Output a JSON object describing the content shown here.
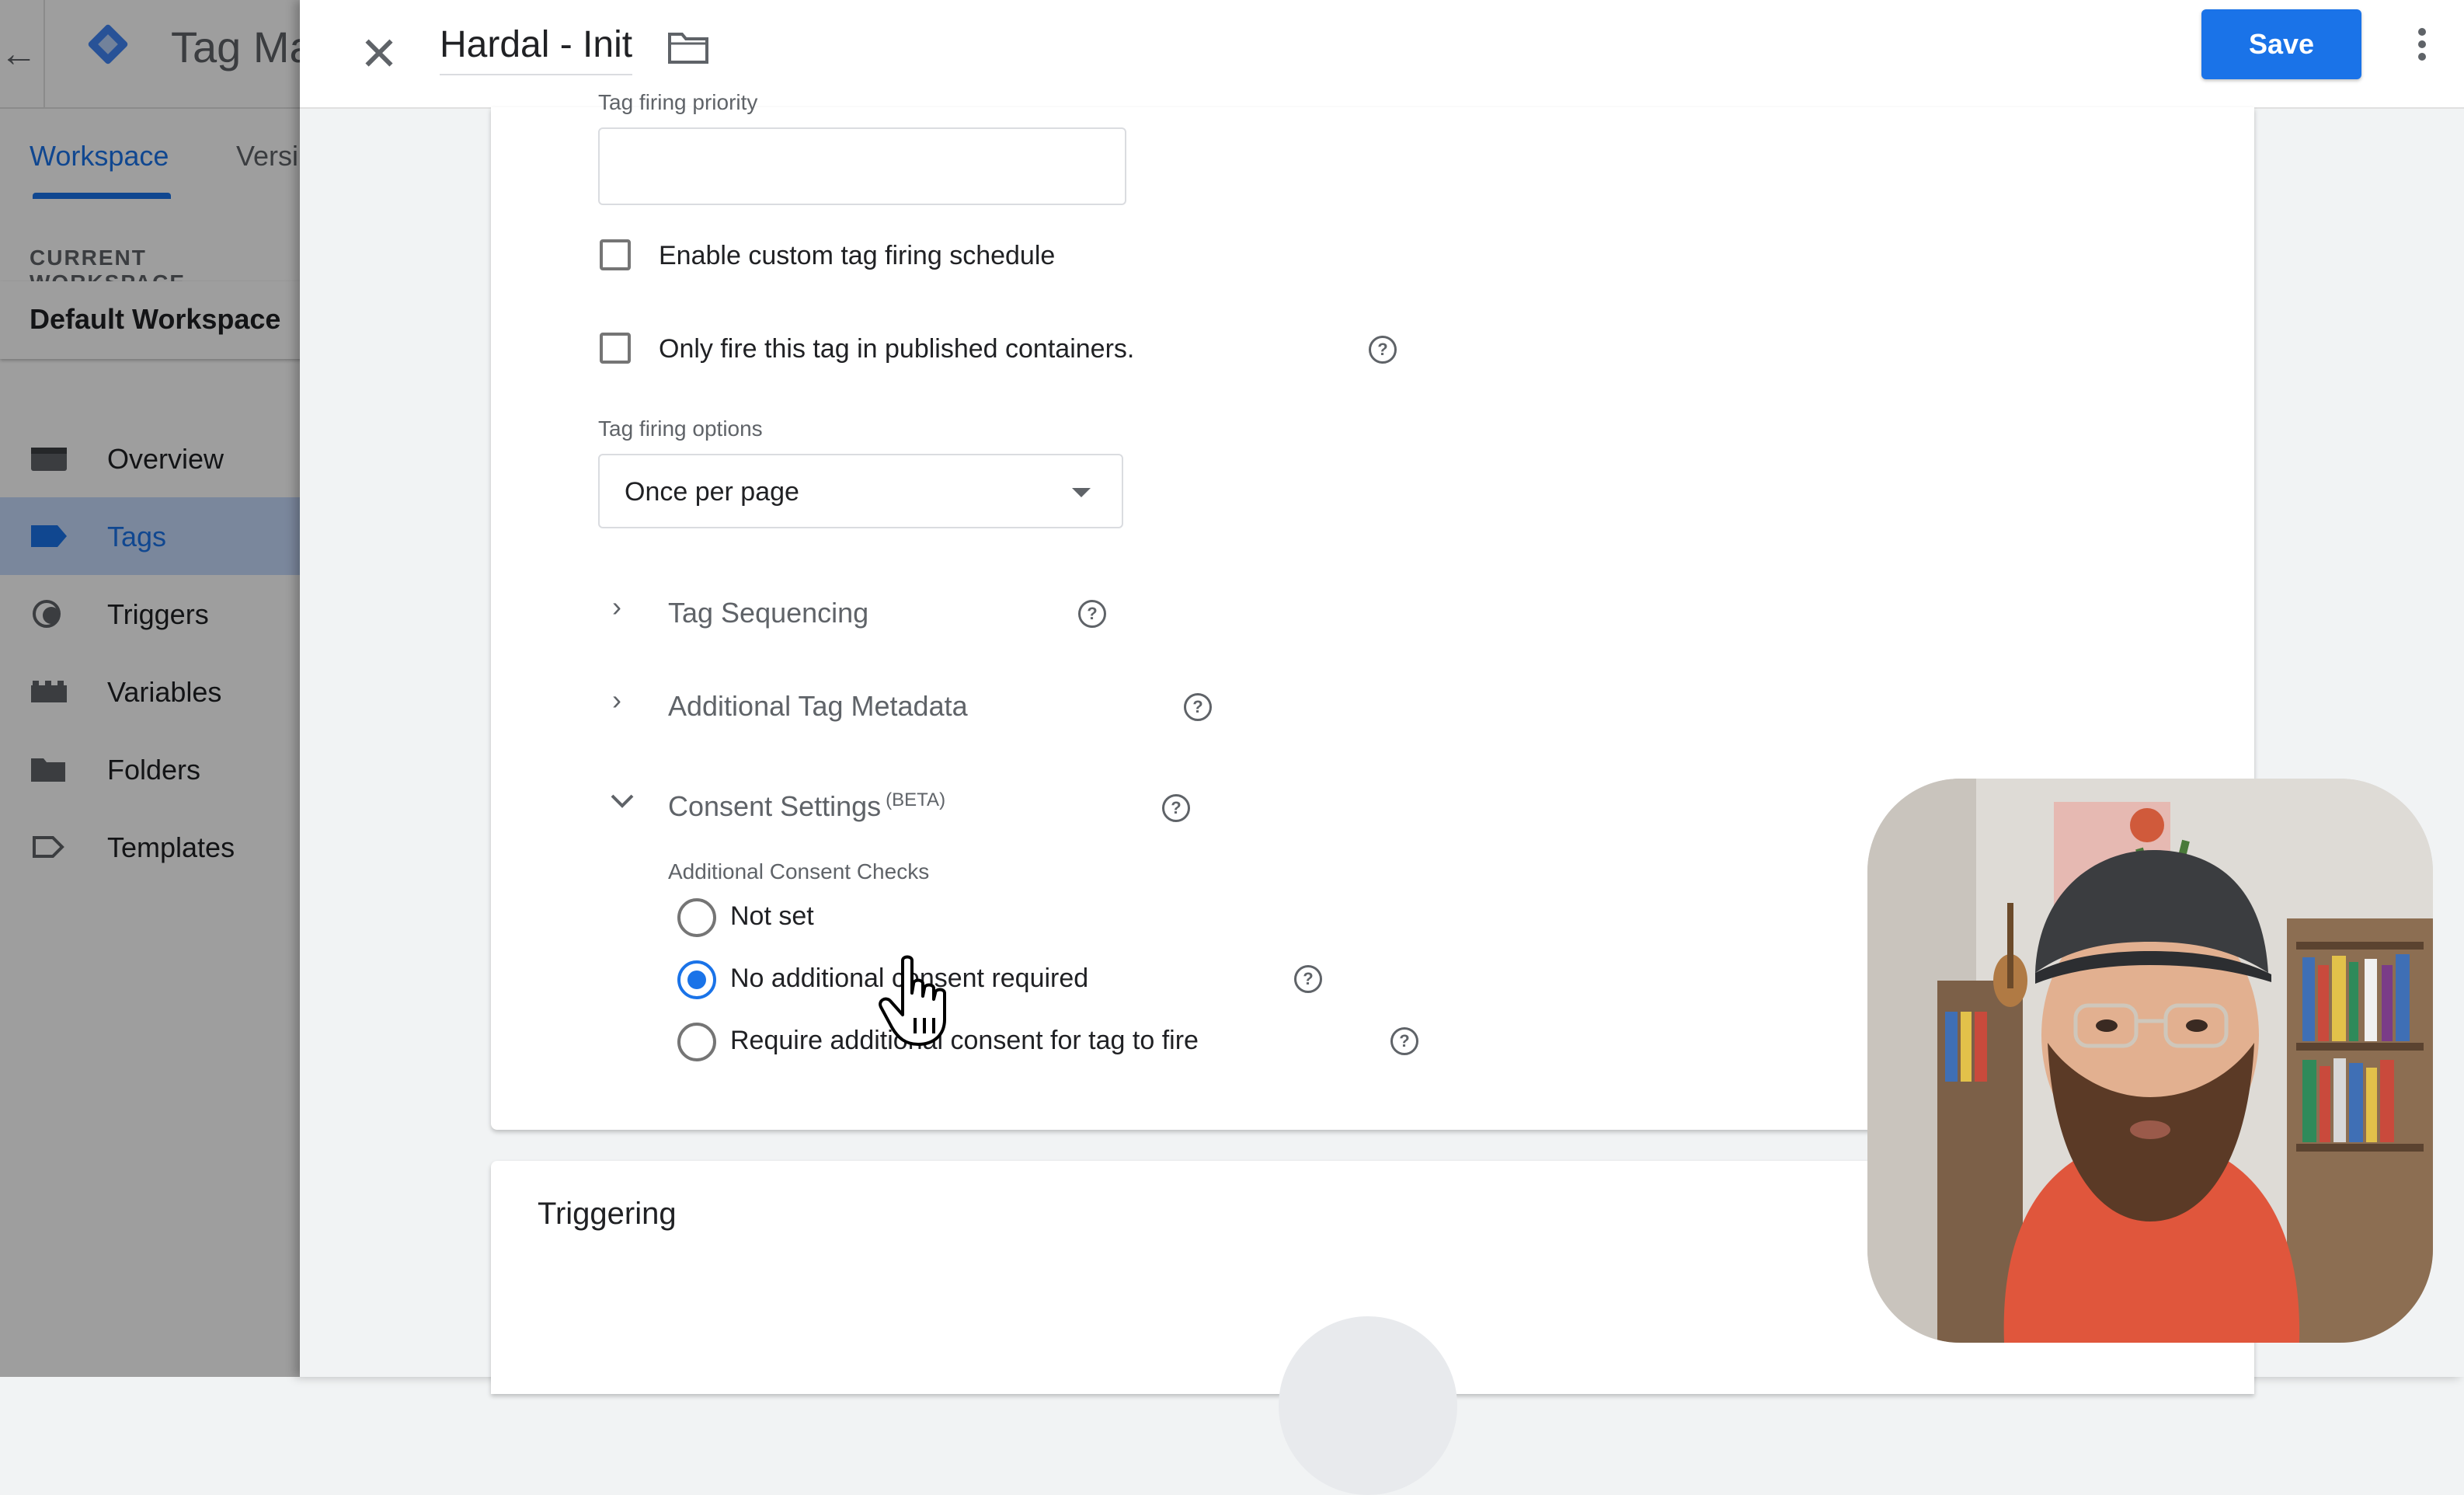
{
  "app": {
    "title": "Tag Ma",
    "tabs": [
      {
        "label": "Workspace",
        "active": true
      },
      {
        "label": "Versi",
        "active": false
      }
    ],
    "workspace": {
      "section_label": "CURRENT WORKSPACE",
      "name": "Default Workspace"
    },
    "nav": [
      {
        "label": "Overview",
        "icon": "overview-icon",
        "active": false
      },
      {
        "label": "Tags",
        "icon": "tag-icon",
        "active": true
      },
      {
        "label": "Triggers",
        "icon": "trigger-icon",
        "active": false
      },
      {
        "label": "Variables",
        "icon": "variables-icon",
        "active": false
      },
      {
        "label": "Folders",
        "icon": "folder-icon",
        "active": false
      },
      {
        "label": "Templates",
        "icon": "template-icon",
        "active": false
      }
    ]
  },
  "editor": {
    "tag_name": "Hardal - Init",
    "save_label": "Save",
    "clipped_label": "Tag firing priority",
    "priority_value": "",
    "options": {
      "custom_schedule_label": "Enable custom tag firing schedule",
      "custom_schedule_checked": false,
      "published_only_label": "Only fire this tag in published containers.",
      "published_only_checked": false
    },
    "firing_options": {
      "label": "Tag firing options",
      "value": "Once per page"
    },
    "sections": {
      "sequencing": "Tag Sequencing",
      "metadata": "Additional Tag Metadata",
      "consent": "Consent Settings",
      "consent_badge": "(BETA)"
    },
    "consent": {
      "label": "Additional Consent Checks",
      "options": [
        {
          "label": "Not set",
          "checked": false
        },
        {
          "label": "No additional consent required",
          "checked": true
        },
        {
          "label": "Require additional consent for tag to fire",
          "checked": false
        }
      ]
    },
    "triggering_title": "Triggering"
  },
  "colors": {
    "accent": "#1a73e8",
    "nav_active_bg": "#c6dafc"
  }
}
